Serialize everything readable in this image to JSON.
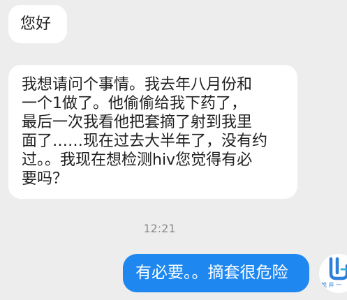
{
  "app": {
    "accent_color": "#1e88f0",
    "background_color": "#ededed"
  },
  "messages": [
    {
      "direction": "incoming",
      "lines": [
        "您好"
      ]
    },
    {
      "direction": "incoming",
      "lines": [
        "我想请问个事情。我去年八月份和",
        "一个1做了。他偷偷给我下药了，",
        "最后一次我看他把套摘了射到我里",
        "面了……现在过去大半年了，没有约",
        "过。。我现在想检测hiv您觉得有必",
        "要吗？"
      ]
    },
    {
      "direction": "outgoing",
      "lines": [
        "有必要。。摘套很危险"
      ]
    }
  ],
  "timestamp": "12:21",
  "avatar": {
    "icon": "hand-heart-logo-icon",
    "caption": "悦 弃 一"
  }
}
